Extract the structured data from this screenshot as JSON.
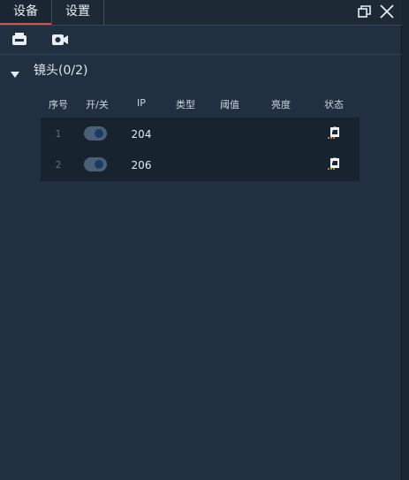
{
  "tabs": [
    {
      "label": "设备",
      "active": true
    },
    {
      "label": "设置",
      "active": false
    }
  ],
  "window_controls": {
    "restore_icon": "restore-icon",
    "close_icon": "close-icon"
  },
  "toolbar": {
    "items": [
      "printer-icon",
      "camera-icon"
    ]
  },
  "group": {
    "title": "镜头(0/2)",
    "expanded": true
  },
  "table": {
    "columns": [
      "序号",
      "开/关",
      "IP",
      "类型",
      "阈值",
      "亮度",
      "状态"
    ],
    "rows": [
      {
        "index": "1",
        "toggle_on": true,
        "ip": "204",
        "type": "",
        "threshold": "",
        "brightness": "",
        "status_icon": "lock-status-icon"
      },
      {
        "index": "2",
        "toggle_on": true,
        "ip": "206",
        "type": "",
        "threshold": "",
        "brightness": "",
        "status_icon": "lock-status-icon"
      }
    ]
  },
  "colors": {
    "background": "#213040",
    "accent": "#d2554a",
    "toggle": "#4a6079"
  }
}
